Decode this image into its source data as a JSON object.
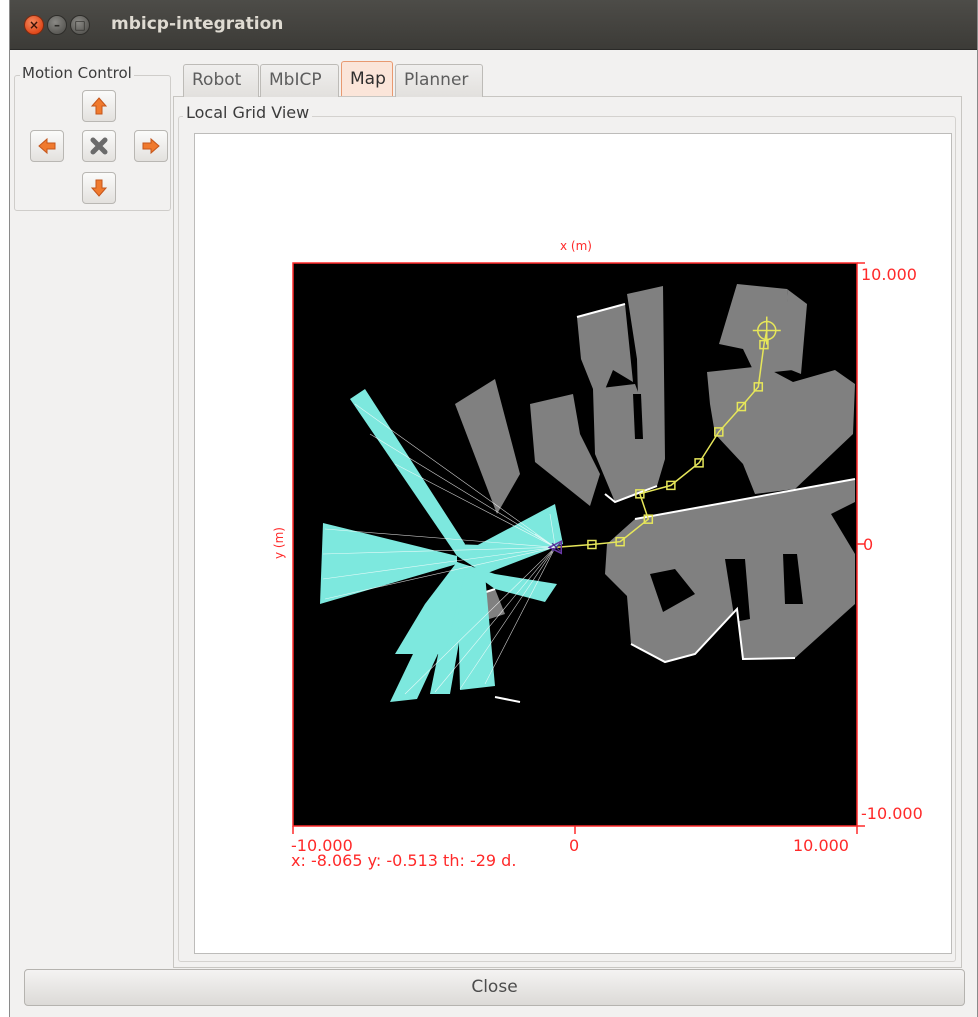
{
  "window": {
    "title": "mbicp-integration"
  },
  "motion_control": {
    "label": "Motion Control",
    "buttons": [
      "up-arrow-icon",
      "left-arrow-icon",
      "stop-x-icon",
      "right-arrow-icon",
      "down-arrow-icon"
    ]
  },
  "tabs": [
    {
      "label": "Robot",
      "active": false
    },
    {
      "label": "MbICP",
      "active": false
    },
    {
      "label": "Map",
      "active": true
    },
    {
      "label": "Planner",
      "active": false
    }
  ],
  "local_grid": {
    "label": "Local Grid View",
    "x_axis_title": "x (m)",
    "y_axis_title": "y (m)",
    "x_min_label": "-10.000",
    "x_zero_label": "0",
    "x_max_label": "10.000",
    "y_max_label": "10.000",
    "y_zero_label": "0",
    "y_min_label": "-10.000",
    "pose_readout": "x: -8.065 y: -0.513 th: -29 d.",
    "path_waypoints_m": [
      [
        -0.7,
        -0.1
      ],
      [
        0.6,
        0.0
      ],
      [
        1.6,
        0.1
      ],
      [
        2.6,
        0.9
      ],
      [
        2.3,
        1.8
      ],
      [
        3.4,
        2.1
      ],
      [
        4.4,
        2.9
      ],
      [
        5.1,
        4.0
      ],
      [
        5.9,
        4.9
      ],
      [
        6.5,
        5.6
      ],
      [
        6.7,
        7.1
      ],
      [
        6.8,
        7.6
      ]
    ],
    "goal_m": [
      6.8,
      7.6
    ],
    "robot_m": [
      -0.7,
      -0.1
    ],
    "colors": {
      "background": "#000000",
      "occupied": "#808080",
      "free": "#ffffff",
      "laser": "#7de8de",
      "path": "#e6e65a",
      "axis": "#ff2a2a"
    }
  },
  "footer": {
    "close_label": "Close"
  }
}
